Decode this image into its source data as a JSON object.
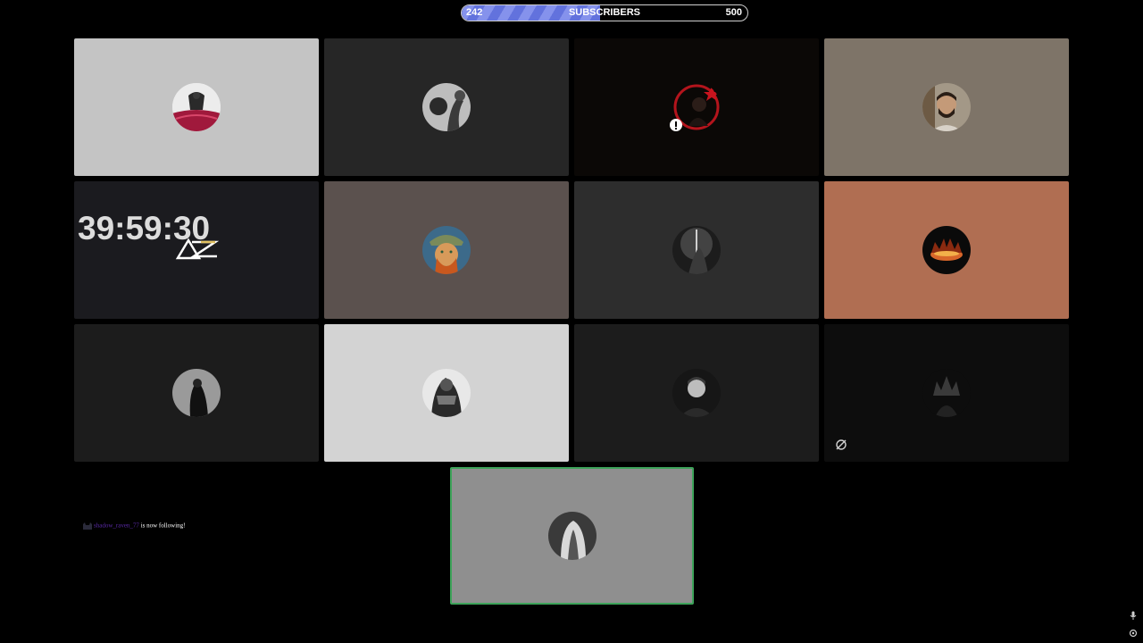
{
  "subscriber_goal": {
    "current": "242",
    "label": "SUBSCRIBERS",
    "target": "500",
    "progress": 0.484,
    "colors": {
      "fill": "#6272dd",
      "fill_stripe": "#8592ec",
      "border": "#cfcfcf"
    }
  },
  "tiles": [
    {
      "name": "tile-1",
      "bg": "#c4c4c4",
      "avatar": "samurai-red-cloth-avatar"
    },
    {
      "name": "tile-2",
      "bg": "#262626",
      "avatar": "grayscale-figure-avatar"
    },
    {
      "name": "tile-3",
      "bg": "#0b0806",
      "avatar": "red-ring-portrait-avatar"
    },
    {
      "name": "tile-4",
      "bg": "#7e7468",
      "avatar": "bearded-man-avatar"
    },
    {
      "name": "tile-5",
      "bg": "#1b1b1f",
      "avatar": "timer-tile"
    },
    {
      "name": "tile-6",
      "bg": "#5b514e",
      "avatar": "van-gogh-avatar"
    },
    {
      "name": "tile-7",
      "bg": "#2d2d2d",
      "avatar": "knight-sword-avatar"
    },
    {
      "name": "tile-8",
      "bg": "#b06e52",
      "avatar": "crown-fire-avatar"
    },
    {
      "name": "tile-9",
      "bg": "#1c1c1c",
      "avatar": "cloaked-figure-avatar"
    },
    {
      "name": "tile-10",
      "bg": "#d3d3d3",
      "avatar": "armored-knight-avatar"
    },
    {
      "name": "tile-11",
      "bg": "#1c1c1c",
      "avatar": "man-portrait-avatar"
    },
    {
      "name": "tile-12",
      "bg": "#0d0d0d",
      "avatar": "dark-crown-avatar"
    },
    {
      "name": "tile-13",
      "bg": "#8f8f8f",
      "avatar": "white-hair-avatar",
      "active_border": "#3ea35a"
    }
  ],
  "timer": {
    "value": "39:59:30",
    "logo": "AZ-logo"
  },
  "follow_alert": {
    "username": "shadow_raven_77",
    "message": " is now following!"
  },
  "corner_icons": [
    "microphone-icon",
    "settings-icon"
  ]
}
